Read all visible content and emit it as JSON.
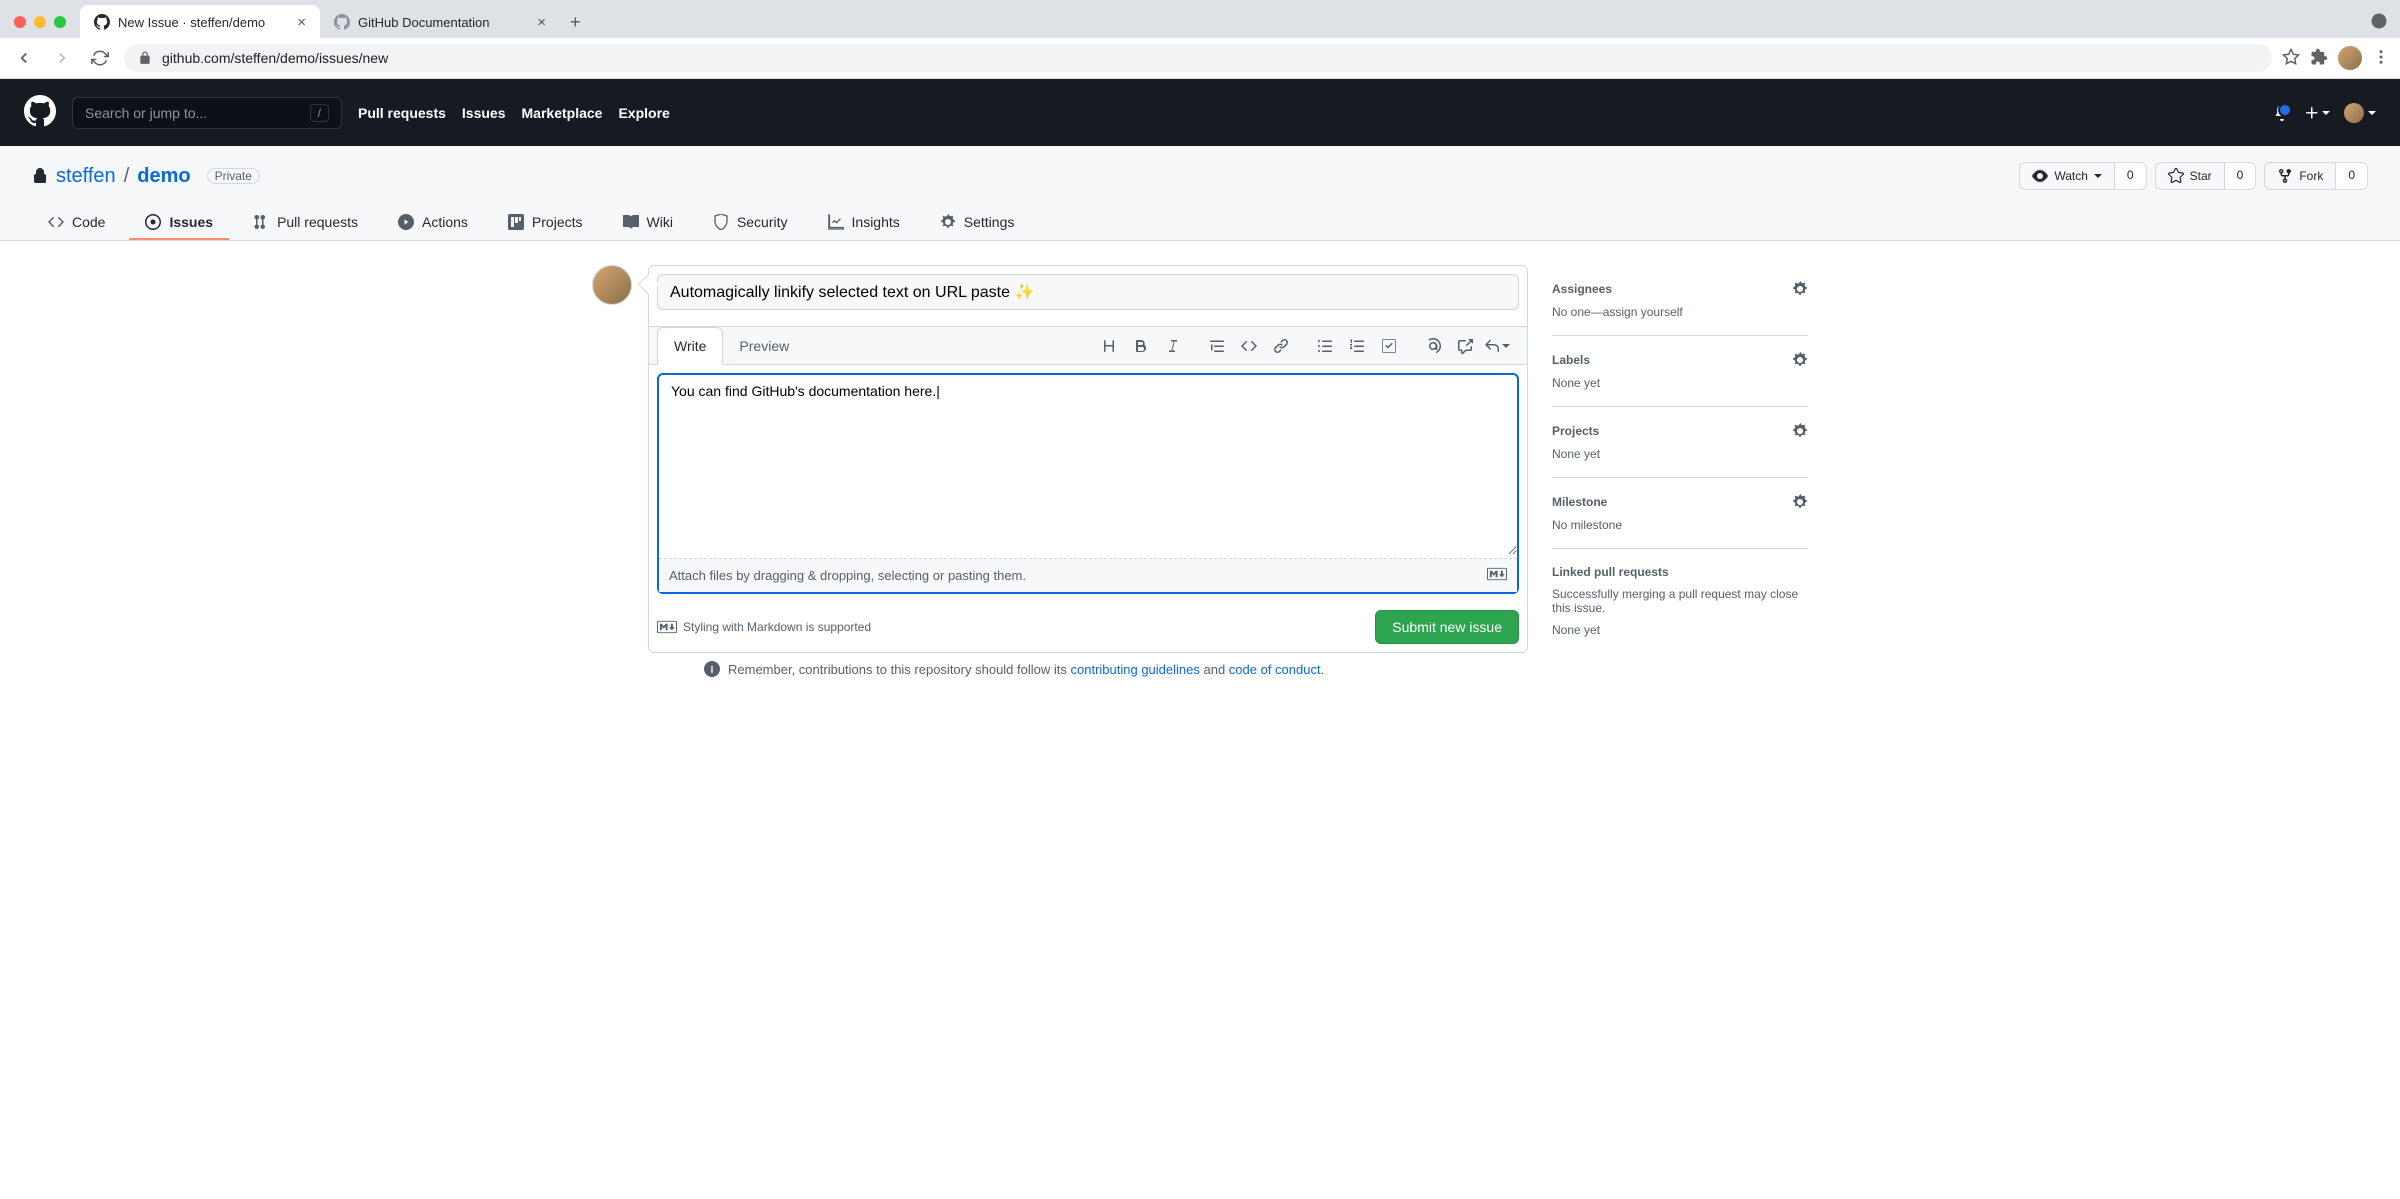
{
  "browser": {
    "tabs": [
      {
        "title": "New Issue · steffen/demo",
        "active": true
      },
      {
        "title": "GitHub Documentation",
        "active": false
      }
    ],
    "url": "github.com/steffen/demo/issues/new"
  },
  "gh_header": {
    "search_placeholder": "Search or jump to...",
    "nav": {
      "pulls": "Pull requests",
      "issues": "Issues",
      "marketplace": "Marketplace",
      "explore": "Explore"
    }
  },
  "repo": {
    "owner": "steffen",
    "name": "demo",
    "visibility": "Private",
    "watch": {
      "label": "Watch",
      "count": "0"
    },
    "star": {
      "label": "Star",
      "count": "0"
    },
    "fork": {
      "label": "Fork",
      "count": "0"
    }
  },
  "repo_tabs": {
    "code": "Code",
    "issues": "Issues",
    "pulls": "Pull requests",
    "actions": "Actions",
    "projects": "Projects",
    "wiki": "Wiki",
    "security": "Security",
    "insights": "Insights",
    "settings": "Settings"
  },
  "issue": {
    "title": "Automagically linkify selected text on URL paste ✨",
    "body": "You can find GitHub's documentation here.",
    "tabs": {
      "write": "Write",
      "preview": "Preview"
    },
    "attach_hint": "Attach files by dragging & dropping, selecting or pasting them.",
    "md_support": "Styling with Markdown is supported",
    "submit": "Submit new issue"
  },
  "contrib": {
    "prefix": "Remember, contributions to this repository should follow its ",
    "guidelines": "contributing guidelines",
    "and": " and ",
    "coc": "code of conduct",
    "suffix": "."
  },
  "sidebar": {
    "assignees": {
      "title": "Assignees",
      "value_prefix": "No one—",
      "link": "assign yourself"
    },
    "labels": {
      "title": "Labels",
      "value": "None yet"
    },
    "projects": {
      "title": "Projects",
      "value": "None yet"
    },
    "milestone": {
      "title": "Milestone",
      "value": "No milestone"
    },
    "linked": {
      "title": "Linked pull requests",
      "desc": "Successfully merging a pull request may close this issue.",
      "value": "None yet"
    }
  }
}
